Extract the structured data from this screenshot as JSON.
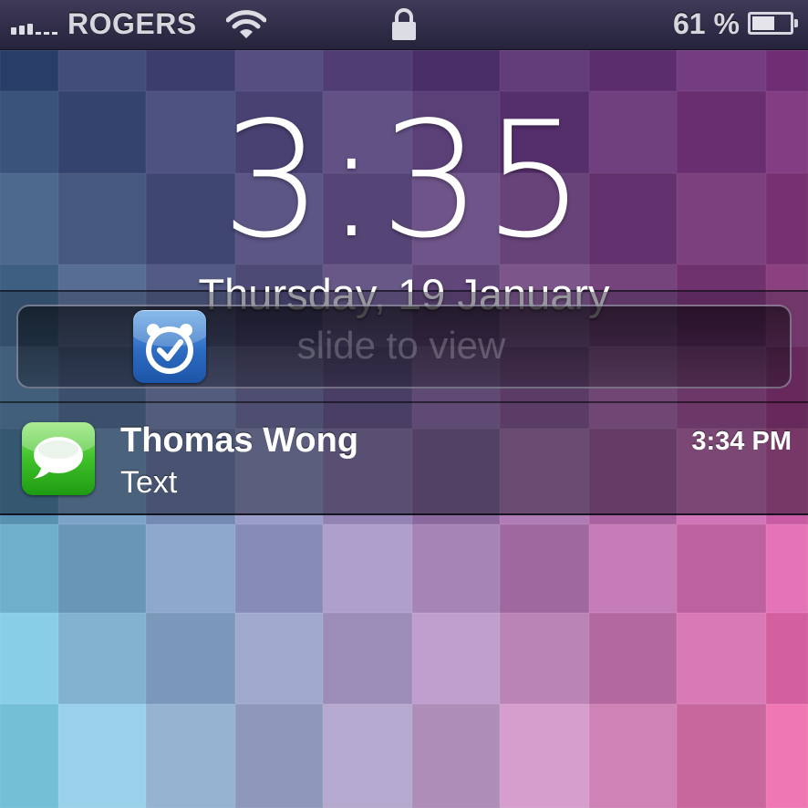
{
  "status_bar": {
    "carrier": "ROGERS",
    "battery_percent_label": "61 %",
    "battery_level": 0.61,
    "icons": [
      "signal-bars-icon",
      "wifi-icon",
      "lock-icon",
      "battery-icon"
    ]
  },
  "lock_screen": {
    "time": "3:35",
    "date": "Thursday, 19 January"
  },
  "notification": {
    "slider_hint": "slide to view",
    "slider_icon": "clock-app-icon",
    "app_icon": "messages-icon",
    "sender": "Thomas Wong",
    "body": "Text",
    "time": "3:34 PM"
  },
  "colors": {
    "messages_green": "#3fc12a",
    "clock_blue": "#2d6cc2",
    "wallpaper_magenta": "#c64a9e",
    "wallpaper_cyan": "#7cc3df"
  }
}
